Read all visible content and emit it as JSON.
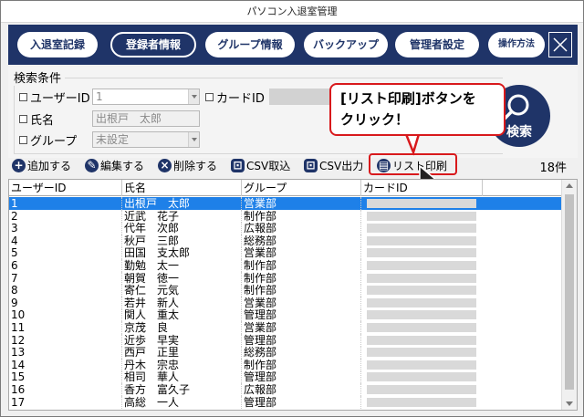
{
  "window": {
    "title": "パソコン入退室管理"
  },
  "nav": [
    {
      "label": "入退室記録",
      "active": false
    },
    {
      "label": "登録者情報",
      "active": true
    },
    {
      "label": "グループ情報",
      "active": false
    },
    {
      "label": "バックアップ",
      "active": false
    },
    {
      "label": "管理者設定",
      "active": false
    },
    {
      "label": "操作方法",
      "active": false
    }
  ],
  "search": {
    "legend": "検索条件",
    "user_id_label": "ユーザーID",
    "user_id_value": "1",
    "card_id_label": "カードID",
    "name_label": "氏名",
    "name_value": "出根戸　太郎",
    "group_label": "グループ",
    "group_value": "未設定",
    "button_label": "検索"
  },
  "callout": {
    "line1": "[リスト印刷]ボタンを",
    "line2": "クリック！"
  },
  "toolbar": {
    "add": "追加する",
    "edit": "編集する",
    "delete": "削除する",
    "csv_import": "CSV取込",
    "csv_export": "CSV出力",
    "print_list": "リスト印刷",
    "count": "18件"
  },
  "table": {
    "columns": [
      "ユーザーID",
      "氏名",
      "グループ",
      "カードID"
    ],
    "rows": [
      {
        "id": "1",
        "name": "出根戸　太郎",
        "group": "営業部",
        "selected": true
      },
      {
        "id": "2",
        "name": "近武　花子",
        "group": "制作部"
      },
      {
        "id": "3",
        "name": "代年　次郎",
        "group": "広報部"
      },
      {
        "id": "4",
        "name": "秋戸　三郎",
        "group": "総務部"
      },
      {
        "id": "5",
        "name": "田国　支太郎",
        "group": "営業部"
      },
      {
        "id": "6",
        "name": "勤勉　太一",
        "group": "制作部"
      },
      {
        "id": "7",
        "name": "朝賀　徳一",
        "group": "制作部"
      },
      {
        "id": "8",
        "name": "寄仁　元気",
        "group": "制作部"
      },
      {
        "id": "9",
        "name": "若井　新人",
        "group": "営業部"
      },
      {
        "id": "10",
        "name": "関人　重太",
        "group": "管理部"
      },
      {
        "id": "11",
        "name": "京茂　良",
        "group": "営業部"
      },
      {
        "id": "12",
        "name": "近歩　早実",
        "group": "管理部"
      },
      {
        "id": "13",
        "name": "西戸　正里",
        "group": "総務部"
      },
      {
        "id": "14",
        "name": "丹木　宗忠",
        "group": "制作部"
      },
      {
        "id": "15",
        "name": "相司　華人",
        "group": "管理部"
      },
      {
        "id": "16",
        "name": "香方　富久子",
        "group": "広報部"
      },
      {
        "id": "17",
        "name": "高総　一人",
        "group": "管理部"
      }
    ]
  },
  "colors": {
    "navy": "#1f3468",
    "selection": "#1e80e8",
    "highlight_red": "#d8191c"
  }
}
